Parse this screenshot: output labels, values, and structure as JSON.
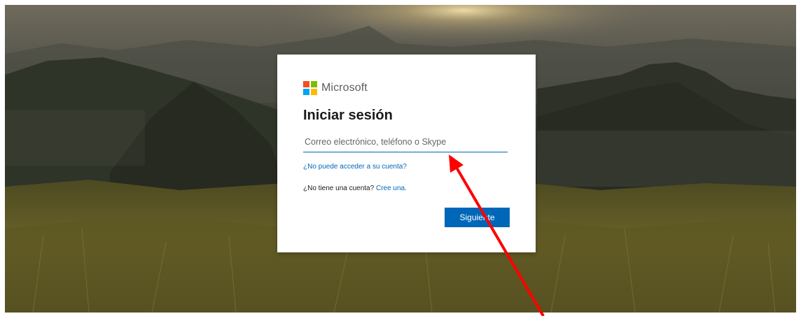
{
  "logo": {
    "text": "Microsoft",
    "colors": [
      "#f25022",
      "#7fba00",
      "#00a4ef",
      "#ffb900"
    ]
  },
  "signin": {
    "title": "Iniciar sesión",
    "input_placeholder": "Correo electrónico, teléfono o Skype",
    "cant_access_link": "¿No puede acceder a su cuenta?",
    "no_account_text": "¿No tiene una cuenta?",
    "create_link": "Cree una.",
    "next_button": "Siguiente"
  },
  "annotation": {
    "arrow_color": "#ff0000"
  },
  "theme": {
    "accent": "#0067b8"
  }
}
